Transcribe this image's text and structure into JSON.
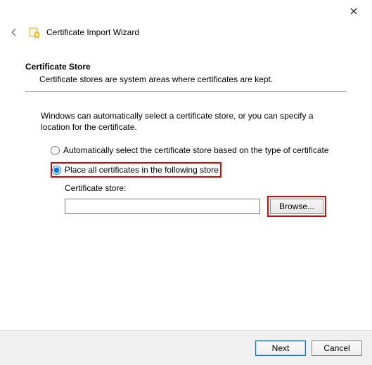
{
  "header": {
    "title": "Certificate Import Wizard"
  },
  "section": {
    "heading": "Certificate Store",
    "subheading": "Certificate stores are system areas where certificates are kept."
  },
  "body": {
    "intro": "Windows can automatically select a certificate store, or you can specify a location for the certificate.",
    "radio_auto": "Automatically select the certificate store based on the type of certificate",
    "radio_place": "Place all certificates in the following store",
    "store_label": "Certificate store:",
    "store_value": "",
    "browse_label": "Browse..."
  },
  "footer": {
    "next": "Next",
    "cancel": "Cancel"
  }
}
